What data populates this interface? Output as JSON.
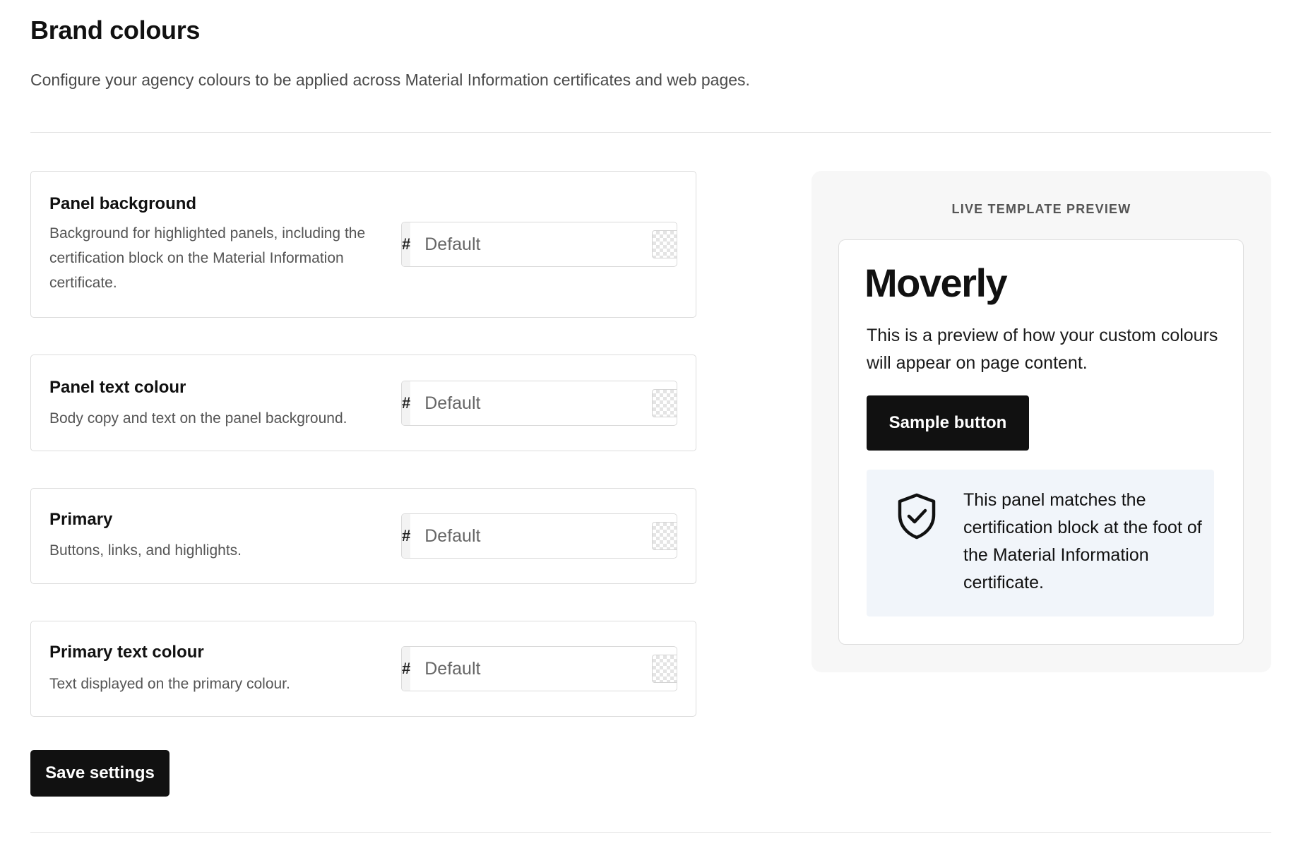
{
  "header": {
    "title": "Brand colours",
    "description": "Configure your agency colours to be applied across Material Information certificates and web pages."
  },
  "settings": [
    {
      "title": "Panel background",
      "description": "Background for highlighted panels, including the certification block on the Material Information certificate.",
      "prefix": "#",
      "placeholder": "Default",
      "value": ""
    },
    {
      "title": "Panel text colour",
      "description": "Body copy and text on the panel background.",
      "prefix": "#",
      "placeholder": "Default",
      "value": ""
    },
    {
      "title": "Primary",
      "description": "Buttons, links, and highlights.",
      "prefix": "#",
      "placeholder": "Default",
      "value": ""
    },
    {
      "title": "Primary text colour",
      "description": "Text displayed on the primary colour.",
      "prefix": "#",
      "placeholder": "Default",
      "value": ""
    }
  ],
  "actions": {
    "save_label": "Save settings"
  },
  "preview": {
    "label": "LIVE TEMPLATE PREVIEW",
    "brand_name": "Moverly",
    "text": "This is a preview of how your custom colours will appear on page content.",
    "sample_button_label": "Sample button",
    "panel_icon": "shield-check-icon",
    "panel_text": "This panel matches the certification block at the foot of the Material Information certificate."
  },
  "colors": {
    "primary": "#111111",
    "primary_text": "#ffffff",
    "panel_background": "#f1f5fa",
    "preview_background": "#f7f7f7"
  }
}
